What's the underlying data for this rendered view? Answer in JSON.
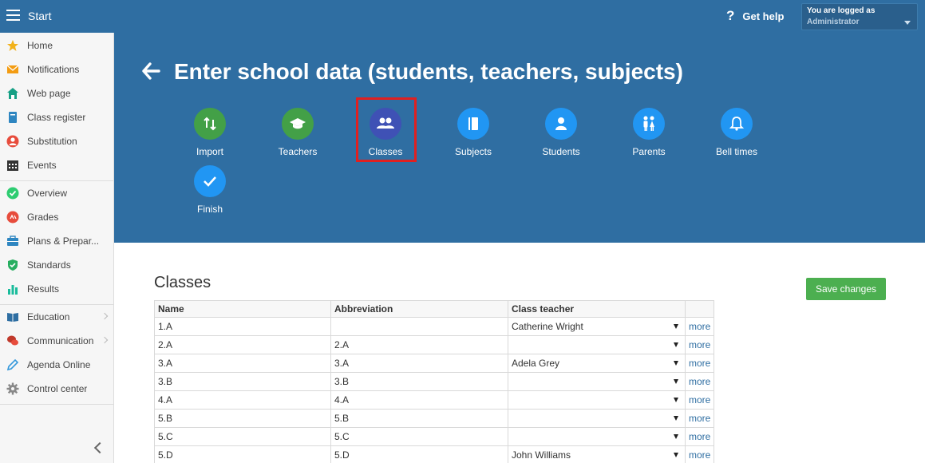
{
  "topbar": {
    "start_label": "Start",
    "help_label": "Get help",
    "login_line1": "You are logged as",
    "login_line2": "Administrator"
  },
  "sidebar": {
    "groups": [
      [
        {
          "label": "Home",
          "icon": "star-icon",
          "color": "#f2b21b"
        },
        {
          "label": "Notifications",
          "icon": "envelope-icon",
          "color": "#f39c12"
        },
        {
          "label": "Web page",
          "icon": "house-icon",
          "color": "#16a085"
        },
        {
          "label": "Class register",
          "icon": "book-icon",
          "color": "#2e86c1"
        },
        {
          "label": "Substitution",
          "icon": "person-icon",
          "color": "#e74c3c"
        },
        {
          "label": "Events",
          "icon": "calendar-icon",
          "color": "#333333"
        }
      ],
      [
        {
          "label": "Overview",
          "icon": "check-circle-icon",
          "color": "#2ecc71"
        },
        {
          "label": "Grades",
          "icon": "grades-icon",
          "color": "#e74c3c"
        },
        {
          "label": "Plans & Prepar...",
          "icon": "briefcase-icon",
          "color": "#2e86c1"
        },
        {
          "label": "Standards",
          "icon": "shield-check-icon",
          "color": "#27ae60"
        },
        {
          "label": "Results",
          "icon": "bar-chart-icon",
          "color": "#1abc9c"
        }
      ],
      [
        {
          "label": "Education",
          "icon": "open-book-icon",
          "color": "#2e6ea2",
          "chevron": true
        },
        {
          "label": "Communication",
          "icon": "chat-icon",
          "color": "#c0392b",
          "chevron": true
        },
        {
          "label": "Agenda Online",
          "icon": "pen-icon",
          "color": "#3498db"
        },
        {
          "label": "Control center",
          "icon": "gear-icon",
          "color": "#888888"
        }
      ]
    ]
  },
  "hero": {
    "title": "Enter school data (students, teachers, subjects)",
    "steps": [
      {
        "label": "Import",
        "icon": "import-arrows-icon",
        "color": "#43a047"
      },
      {
        "label": "Teachers",
        "icon": "graduation-cap-icon",
        "color": "#43a047"
      },
      {
        "label": "Classes",
        "icon": "people-icon",
        "color": "#3f51b5",
        "active": true
      },
      {
        "label": "Subjects",
        "icon": "book-icon",
        "color": "#2196f3"
      },
      {
        "label": "Students",
        "icon": "person-icon",
        "color": "#2196f3"
      },
      {
        "label": "Parents",
        "icon": "parents-icon",
        "color": "#2196f3"
      },
      {
        "label": "Bell times",
        "icon": "bell-icon",
        "color": "#2196f3"
      },
      {
        "label": "Finish",
        "icon": "checkmark-icon",
        "color": "#2196f3"
      }
    ]
  },
  "content": {
    "title": "Classes",
    "save_label": "Save changes",
    "columns": [
      "Name",
      "Abbreviation",
      "Class teacher",
      ""
    ],
    "more_label": "more",
    "rows": [
      {
        "name": "1.A",
        "abbr": "",
        "teacher": "Catherine Wright"
      },
      {
        "name": "2.A",
        "abbr": "2.A",
        "teacher": ""
      },
      {
        "name": "3.A",
        "abbr": "3.A",
        "teacher": "Adela Grey"
      },
      {
        "name": "3.B",
        "abbr": "3.B",
        "teacher": ""
      },
      {
        "name": "4.A",
        "abbr": "4.A",
        "teacher": ""
      },
      {
        "name": "5.B",
        "abbr": "5.B",
        "teacher": ""
      },
      {
        "name": "5.C",
        "abbr": "5.C",
        "teacher": ""
      },
      {
        "name": "5.D",
        "abbr": "5.D",
        "teacher": "John Williams"
      }
    ]
  }
}
